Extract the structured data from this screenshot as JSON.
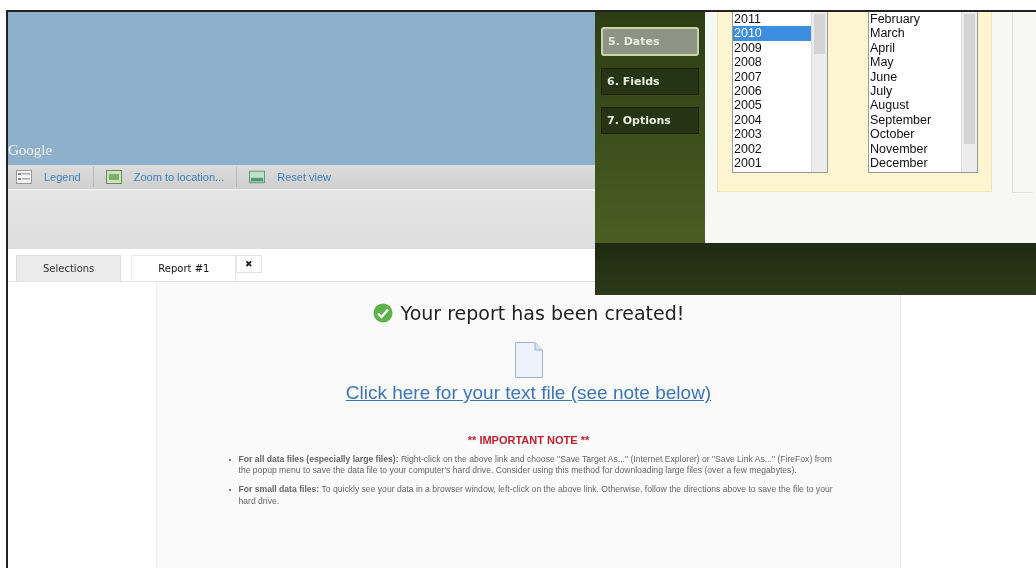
{
  "map": {
    "attribution": "Google"
  },
  "toolbar": [
    {
      "label": "Legend",
      "kind": "legend"
    },
    {
      "label": "Zoom to location...",
      "kind": "zoom"
    },
    {
      "label": "Reset view",
      "kind": "reset"
    }
  ],
  "tabs": [
    {
      "label": "Selections",
      "selected": false
    },
    {
      "label": "Report #1",
      "selected": true,
      "close": "✖"
    }
  ],
  "report": {
    "heading": "Your report has been created!",
    "link": "Click here for your text file (see note below)",
    "note_title": "** IMPORTANT NOTE **",
    "notes": [
      "**For all data files (especially large files):** Right-click on the above link and choose \"Save Target As...\" (Internet Explorer) or \"Save Link As...\" (FireFox) from the popup menu to save the data file to your computer's hard drive. Consider using this method for downloading large files (over a few megabytes).",
      "**For small data files:** To quickly see your data in a browser window, left-click on the above link. Otherwise, follow the directions above to save the file to your hard drive."
    ]
  },
  "dialog": {
    "steps": [
      {
        "label": "5. Dates",
        "selected": true
      },
      {
        "label": "6. Fields",
        "selected": false
      },
      {
        "label": "7. Options",
        "selected": false
      }
    ],
    "years": [
      {
        "label": "2011",
        "selected": false
      },
      {
        "label": "2010",
        "selected": true
      },
      {
        "label": "2009",
        "selected": false
      },
      {
        "label": "2008",
        "selected": false
      },
      {
        "label": "2007",
        "selected": false
      },
      {
        "label": "2006",
        "selected": false
      },
      {
        "label": "2005",
        "selected": false
      },
      {
        "label": "2004",
        "selected": false
      },
      {
        "label": "2003",
        "selected": false
      },
      {
        "label": "2002",
        "selected": false
      },
      {
        "label": "2001",
        "selected": false
      }
    ],
    "months": [
      "February",
      "March",
      "April",
      "May",
      "June",
      "July",
      "August",
      "September",
      "October",
      "November",
      "December"
    ]
  }
}
